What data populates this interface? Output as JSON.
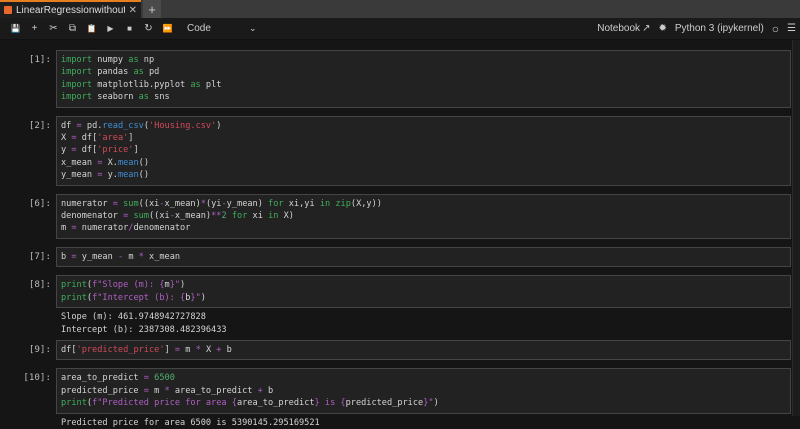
{
  "tab": {
    "title": "LinearRegressionwithoutsscik",
    "close": "✕",
    "new": "+"
  },
  "toolbar": {
    "save": "💾",
    "add": "+",
    "cut": "✂",
    "copy": "⧉",
    "paste": "📋",
    "run": "▶",
    "stop": "■",
    "restart": "↻",
    "run_all": "⏩",
    "cell_type": "Code",
    "chevron": "⌄",
    "notebook_label": "Notebook",
    "external": "↗",
    "bug": "✹",
    "kernel": "Python 3 (ipykernel)",
    "kernel_status": "○",
    "menu": "☰"
  },
  "cells": [
    {
      "prompt": "[1]:",
      "lines": [
        [
          [
            "import",
            "kw"
          ],
          [
            " numpy ",
            ""
          ],
          [
            "as",
            "kw"
          ],
          [
            " np",
            ""
          ]
        ],
        [
          [
            "import",
            "kw"
          ],
          [
            " pandas ",
            ""
          ],
          [
            "as",
            "kw"
          ],
          [
            " pd",
            ""
          ]
        ],
        [
          [
            "import",
            "kw"
          ],
          [
            " matplotlib.pyplot ",
            ""
          ],
          [
            "as",
            "kw"
          ],
          [
            " plt",
            ""
          ]
        ],
        [
          [
            "import",
            "kw"
          ],
          [
            " seaborn ",
            ""
          ],
          [
            "as",
            "kw"
          ],
          [
            " sns",
            ""
          ]
        ]
      ]
    },
    {
      "prompt": "[2]:",
      "lines": [
        [
          [
            "df ",
            ""
          ],
          [
            "=",
            "op"
          ],
          [
            " pd.",
            ""
          ],
          [
            "read_csv",
            "fn"
          ],
          [
            "(",
            ""
          ],
          [
            "'Housing.csv'",
            "st"
          ],
          [
            ")",
            ""
          ]
        ],
        [
          [
            "X ",
            ""
          ],
          [
            "=",
            "op"
          ],
          [
            " df[",
            ""
          ],
          [
            "'area'",
            "st"
          ],
          [
            "]",
            ""
          ]
        ],
        [
          [
            "y ",
            ""
          ],
          [
            "=",
            "op"
          ],
          [
            " df[",
            ""
          ],
          [
            "'price'",
            "st"
          ],
          [
            "]",
            ""
          ]
        ],
        [
          [
            "x_mean ",
            ""
          ],
          [
            "=",
            "op"
          ],
          [
            " X.",
            ""
          ],
          [
            "mean",
            "fn"
          ],
          [
            "()",
            ""
          ]
        ],
        [
          [
            "y_mean ",
            ""
          ],
          [
            "=",
            "op"
          ],
          [
            " y.",
            ""
          ],
          [
            "mean",
            "fn"
          ],
          [
            "()",
            ""
          ]
        ]
      ]
    },
    {
      "prompt": "[6]:",
      "lines": [
        [
          [
            "numerator ",
            ""
          ],
          [
            "=",
            "op"
          ],
          [
            " ",
            ""
          ],
          [
            "sum",
            "kw"
          ],
          [
            "((xi",
            ""
          ],
          [
            "-",
            "op"
          ],
          [
            "x_mean)",
            ""
          ],
          [
            "*",
            "op"
          ],
          [
            "(yi",
            ""
          ],
          [
            "-",
            "op"
          ],
          [
            "y_mean) ",
            ""
          ],
          [
            "for",
            "kw"
          ],
          [
            " xi,yi ",
            ""
          ],
          [
            "in",
            "kw"
          ],
          [
            " ",
            ""
          ],
          [
            "zip",
            "kw"
          ],
          [
            "(X,y))",
            ""
          ]
        ],
        [
          [
            "denomenator ",
            ""
          ],
          [
            "=",
            "op"
          ],
          [
            " ",
            ""
          ],
          [
            "sum",
            "kw"
          ],
          [
            "((xi",
            ""
          ],
          [
            "-",
            "op"
          ],
          [
            "x_mean)",
            ""
          ],
          [
            "**",
            "op"
          ],
          [
            "2",
            "nu"
          ],
          [
            " ",
            ""
          ],
          [
            "for",
            "kw"
          ],
          [
            " xi ",
            ""
          ],
          [
            "in",
            "kw"
          ],
          [
            " X)",
            ""
          ]
        ],
        [
          [
            "m ",
            ""
          ],
          [
            "=",
            "op"
          ],
          [
            " numerator",
            ""
          ],
          [
            "/",
            "op"
          ],
          [
            "denomenator",
            ""
          ]
        ]
      ]
    },
    {
      "prompt": "[7]:",
      "lines": [
        [
          [
            "b ",
            ""
          ],
          [
            "=",
            "op"
          ],
          [
            " y_mean ",
            ""
          ],
          [
            "-",
            "op"
          ],
          [
            " m ",
            ""
          ],
          [
            "*",
            "op"
          ],
          [
            " x_mean",
            ""
          ]
        ]
      ]
    },
    {
      "prompt": "[8]:",
      "lines": [
        [
          [
            "print",
            "pr"
          ],
          [
            "(",
            ""
          ],
          [
            "f\"Slope (m): {",
            "fs"
          ],
          [
            "m",
            ""
          ],
          [
            "}\"",
            "fs"
          ],
          [
            ")",
            ""
          ]
        ],
        [
          [
            "print",
            "pr"
          ],
          [
            "(",
            ""
          ],
          [
            "f\"Intercept (b): {",
            "fs"
          ],
          [
            "b",
            ""
          ],
          [
            "}\"",
            "fs"
          ],
          [
            ")",
            ""
          ]
        ]
      ],
      "output": "Slope (m): 461.9748942727828\nIntercept (b): 2387308.482396433"
    },
    {
      "prompt": "[9]:",
      "lines": [
        [
          [
            "df[",
            ""
          ],
          [
            "'predicted_price'",
            "st"
          ],
          [
            "] ",
            ""
          ],
          [
            "=",
            "op"
          ],
          [
            " m ",
            ""
          ],
          [
            "*",
            "op"
          ],
          [
            " X ",
            ""
          ],
          [
            "+",
            "op"
          ],
          [
            " b",
            ""
          ]
        ]
      ]
    },
    {
      "prompt": "[10]:",
      "lines": [
        [
          [
            "area_to_predict ",
            ""
          ],
          [
            "=",
            "op"
          ],
          [
            " ",
            ""
          ],
          [
            "6500",
            "nu"
          ]
        ],
        [
          [
            "predicted_price ",
            ""
          ],
          [
            "=",
            "op"
          ],
          [
            " m ",
            ""
          ],
          [
            "*",
            "op"
          ],
          [
            " area_to_predict ",
            ""
          ],
          [
            "+",
            "op"
          ],
          [
            " b",
            ""
          ]
        ],
        [
          [
            "print",
            "pr"
          ],
          [
            "(",
            ""
          ],
          [
            "f\"Predicted price for area {",
            "fs"
          ],
          [
            "area_to_predict",
            ""
          ],
          [
            "} is {",
            "fs"
          ],
          [
            "predicted_price",
            ""
          ],
          [
            "}\"",
            "fs"
          ],
          [
            ")",
            ""
          ]
        ]
      ],
      "output": "Predicted price for area 6500 is 5390145.295169521"
    }
  ]
}
